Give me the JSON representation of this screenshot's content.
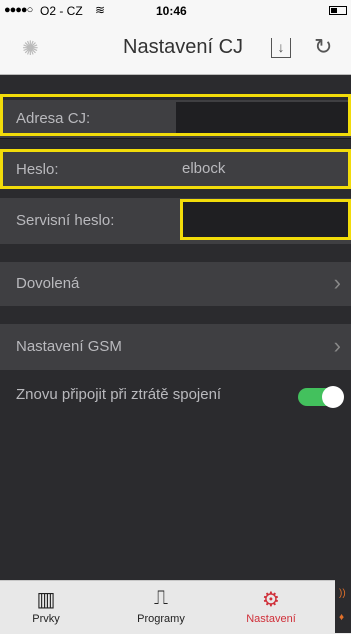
{
  "status_bar": {
    "signal": "●●●●○",
    "carrier": "O2 - CZ",
    "wifi_icon": "wifi-icon",
    "time": "10:46"
  },
  "nav": {
    "title": "Nastavení CJ",
    "spinner_icon": "spinner-icon",
    "download_icon": "download-icon",
    "refresh_icon": "refresh-icon"
  },
  "form": {
    "address_label": "Adresa CJ:",
    "address_value": "",
    "password_label": "Heslo:",
    "password_value": "elbock",
    "service_password_label": "Servisní heslo:",
    "service_password_value": ""
  },
  "menu": {
    "vacation_label": "Dovolená",
    "gsm_label": "Nastavení GSM",
    "reconnect_label": "Znovu připojit při ztrátě spojení",
    "reconnect_enabled": true
  },
  "tabs": [
    {
      "label": "Prvky",
      "icon": "radiator-icon"
    },
    {
      "label": "Programy",
      "icon": "program-icon"
    },
    {
      "label": "Nastavení",
      "icon": "gears-icon"
    }
  ],
  "colors": {
    "highlight": "#f2dc0a",
    "active_tab": "#d0303a",
    "toggle_on": "#43c15d"
  }
}
